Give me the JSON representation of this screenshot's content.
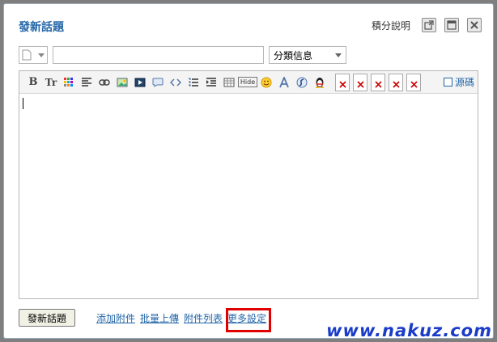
{
  "dialog": {
    "title": "發新話題",
    "score_link": "積分說明",
    "window_buttons": [
      "popout-icon",
      "maximize-icon",
      "close-icon"
    ]
  },
  "subject": {
    "value": "",
    "category": "分類信息"
  },
  "toolbar": {
    "bold": "B",
    "font_size": "Tr",
    "source_label": "源碼",
    "hide_label": "Hide"
  },
  "bottom": {
    "submit_label": "發新話題",
    "links": [
      "添加附件",
      "批量上傳",
      "附件列表",
      "更多設定"
    ]
  },
  "watermark": "www.nakuz.com",
  "colors": {
    "accent": "#2366a8",
    "highlight": "#e00000",
    "watermark": "#1a3cc8"
  }
}
